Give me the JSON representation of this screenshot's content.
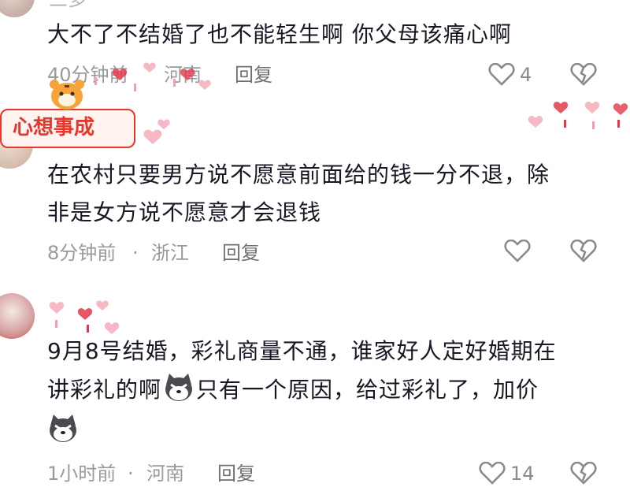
{
  "comments": [
    {
      "username": "三多",
      "text_lines": [
        "大不了不结婚了也不能轻生啊 你父母该痛心啊"
      ],
      "time": "40分钟前",
      "location": "河南",
      "reply_label": "回复",
      "likes": "4"
    },
    {
      "badge": "心想事成",
      "text_lines": [
        "在农村只要男方说不愿意前面给的钱一分不退，除",
        "非是女方说不愿意才会退钱"
      ],
      "time": "8分钟前",
      "separator": "·",
      "location": "浙江",
      "reply_label": "回复",
      "likes": ""
    },
    {
      "text_line1": "9月8号结婚，彩礼商量不通，谁家好人定好婚期在",
      "text_line2a": "讲彩礼的啊",
      "text_line2b": "只有一个原因，给过彩礼了，加价",
      "emoji": "husky-emoji",
      "time": "1小时前",
      "separator": "·",
      "location": "河南",
      "reply_label": "回复",
      "likes": "14"
    }
  ],
  "icons": {
    "like": "heart-outline-icon",
    "dislike": "broken-heart-icon"
  },
  "colors": {
    "text": "#161823",
    "meta": "#9a9a9e",
    "badge_red": "#e8362c",
    "heart_pink": "#f2a0ae"
  }
}
